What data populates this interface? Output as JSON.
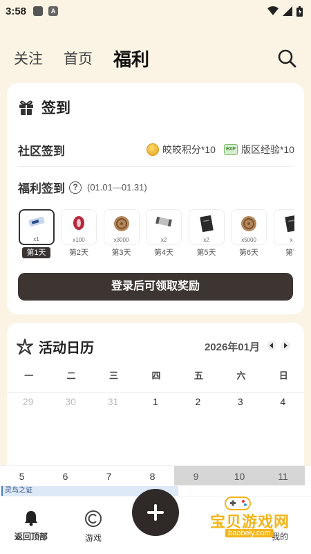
{
  "status_bar": {
    "time": "3:58",
    "icon_a": "A",
    "icons": [
      "app-icon",
      "a-icon",
      "wifi-icon",
      "signal-icon",
      "battery-icon"
    ]
  },
  "top_tabs": {
    "items": [
      "关注",
      "首页",
      "福利"
    ],
    "active": "福利",
    "search_icon": "search-icon"
  },
  "checkin": {
    "title": "签到",
    "title_icon": "gift-icon",
    "community": {
      "label": "社区签到",
      "reward1": "皎皎积分*10",
      "reward2": "版区经验*10",
      "exp_tag": "EXP"
    },
    "welfare": {
      "label": "福利签到",
      "help": "?",
      "range": "(01.01—01.31)"
    },
    "days": [
      {
        "qty": "x1",
        "label": "第1天",
        "active": true,
        "item": "ticket"
      },
      {
        "qty": "x100",
        "label": "第2天",
        "active": false,
        "item": "feather"
      },
      {
        "qty": "x3000",
        "label": "第3天",
        "active": false,
        "item": "coin"
      },
      {
        "qty": "x2",
        "label": "第4天",
        "active": false,
        "item": "scroll"
      },
      {
        "qty": "x2",
        "label": "第5天",
        "active": false,
        "item": "book"
      },
      {
        "qty": "x5000",
        "label": "第6天",
        "active": false,
        "item": "coin"
      },
      {
        "qty": "x",
        "label": "第7",
        "active": false,
        "item": "book"
      }
    ],
    "login_button": "登录后可领取奖励"
  },
  "calendar": {
    "title": "活动日历",
    "title_icon": "star-burst-icon",
    "month": "2026年01月",
    "weekdays": [
      "一",
      "二",
      "三",
      "四",
      "五",
      "六",
      "日"
    ],
    "week1": [
      "29",
      "30",
      "31",
      "1",
      "2",
      "3",
      "4"
    ],
    "week2": [
      "5",
      "6",
      "7",
      "8",
      "9",
      "10",
      "11"
    ],
    "event": "灵鸟之证"
  },
  "bottom_nav": {
    "home": "返回顶部",
    "game": "游戏",
    "mine": "我的"
  },
  "watermark": {
    "text": "宝贝游戏网",
    "url": "baobeiy.com"
  },
  "colors": {
    "accent_dark": "#3c3532",
    "bg": "#fbf3e3",
    "gold": "#f3b417"
  }
}
